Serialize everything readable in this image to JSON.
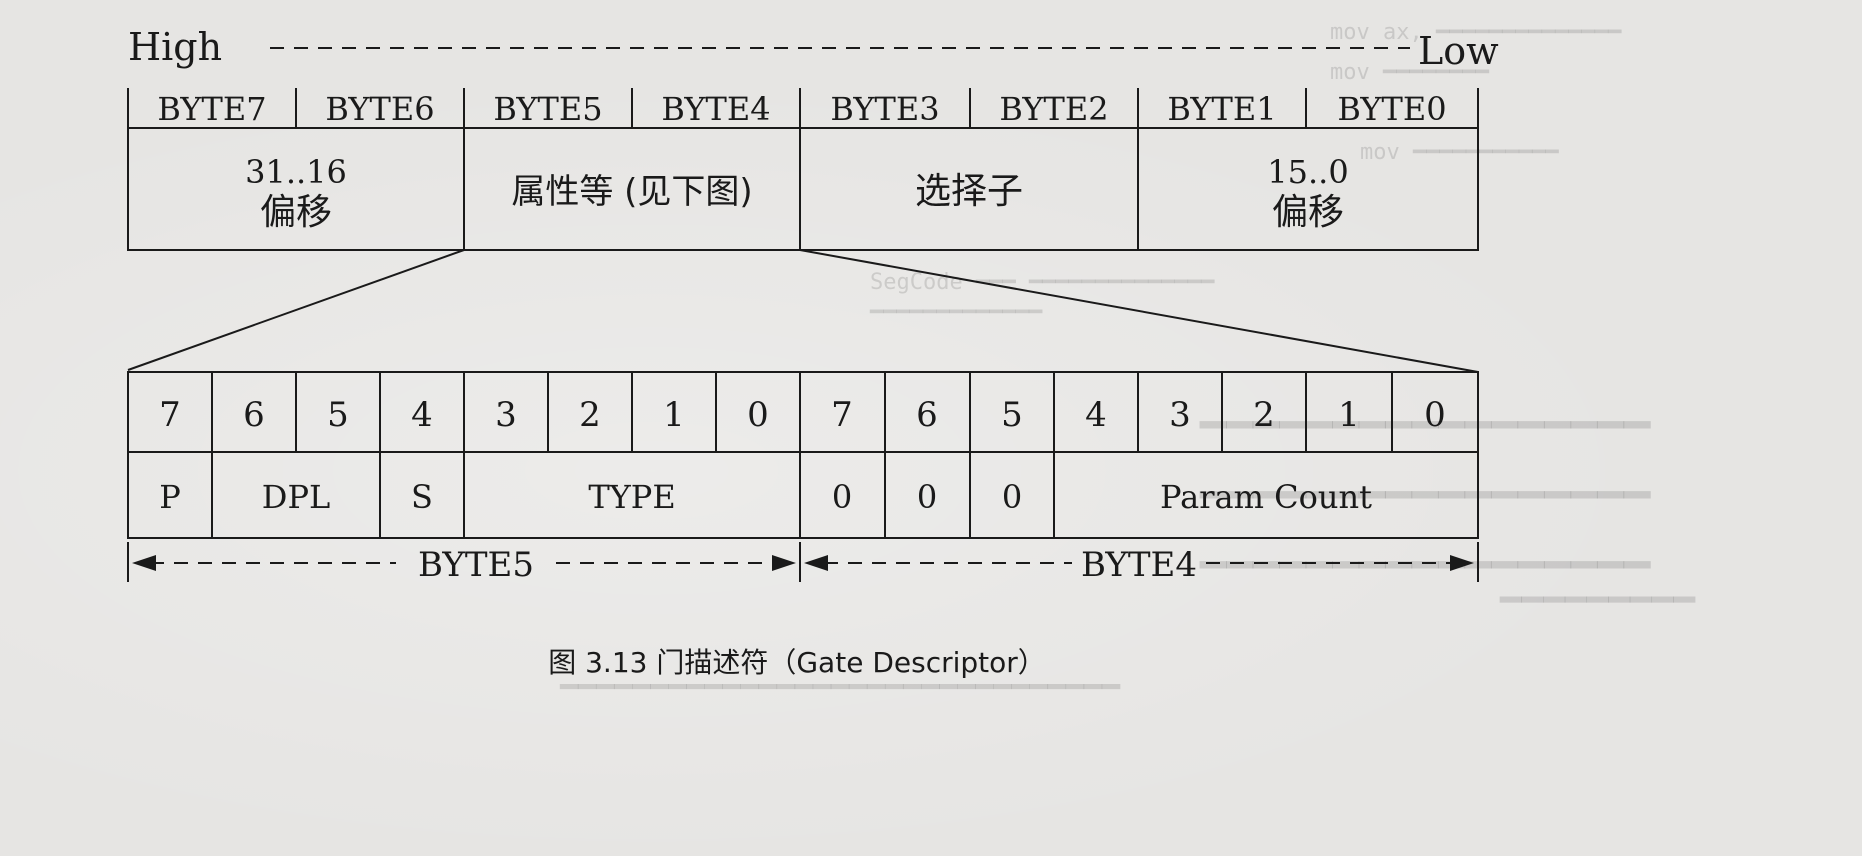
{
  "direction": {
    "high": "High",
    "low": "Low"
  },
  "bytes": [
    "BYTE7",
    "BYTE6",
    "BYTE5",
    "BYTE4",
    "BYTE3",
    "BYTE2",
    "BYTE1",
    "BYTE0"
  ],
  "fields": {
    "offset_high_bits": "31..16",
    "offset_high_label": "偏移",
    "attributes": "属性等 (见下图)",
    "selector": "选择子",
    "offset_low_bits": "15..0",
    "offset_low_label": "偏移"
  },
  "bit_numbers": [
    "7",
    "6",
    "5",
    "4",
    "3",
    "2",
    "1",
    "0",
    "7",
    "6",
    "5",
    "4",
    "3",
    "2",
    "1",
    "0"
  ],
  "bit_fields": {
    "p": "P",
    "dpl": "DPL",
    "s": "S",
    "type": "TYPE",
    "zero_a": "0",
    "zero_b": "0",
    "zero_c": "0",
    "param_count": "Param Count"
  },
  "spans": {
    "byte5": "BYTE5",
    "byte4": "BYTE4"
  },
  "caption": "图 3.13  门描述符（Gate Descriptor）"
}
